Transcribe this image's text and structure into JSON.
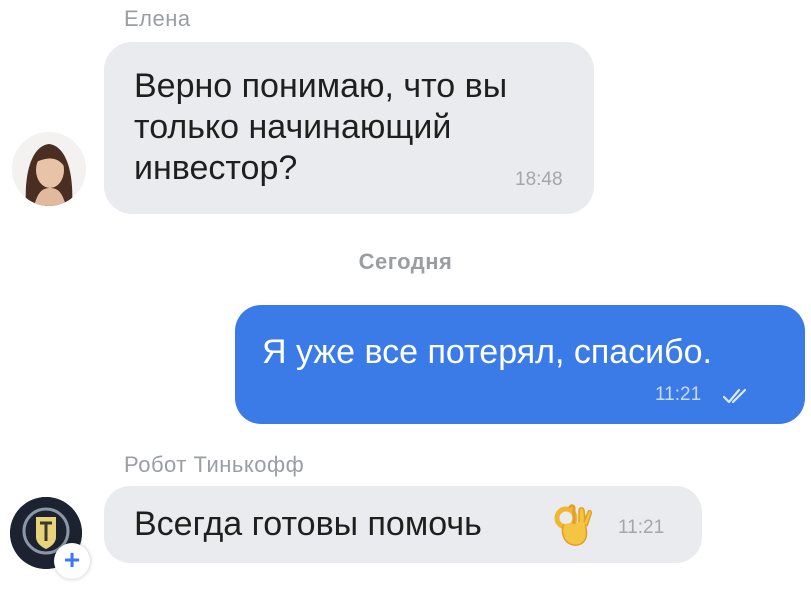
{
  "messages": [
    {
      "sender": "Елена",
      "text": "Верно понимаю, что вы\nтолько начинающий\nинвестор?",
      "time": "18:48"
    },
    {
      "text": "Я уже все потерял, спасибо.",
      "time": "11:21"
    },
    {
      "sender": "Робот Тинькофф",
      "text": "Всегда готовы помочь",
      "time": "11:21"
    }
  ],
  "date_separator": "Сегодня",
  "icons": {
    "read_status": "double-check-icon",
    "emoji": "ok-hand-emoji",
    "badge": "plus-icon"
  },
  "colors": {
    "incoming_bubble": "#e9ebee",
    "outgoing_bubble": "#3a7be8",
    "name_text": "#9a9ea3"
  }
}
